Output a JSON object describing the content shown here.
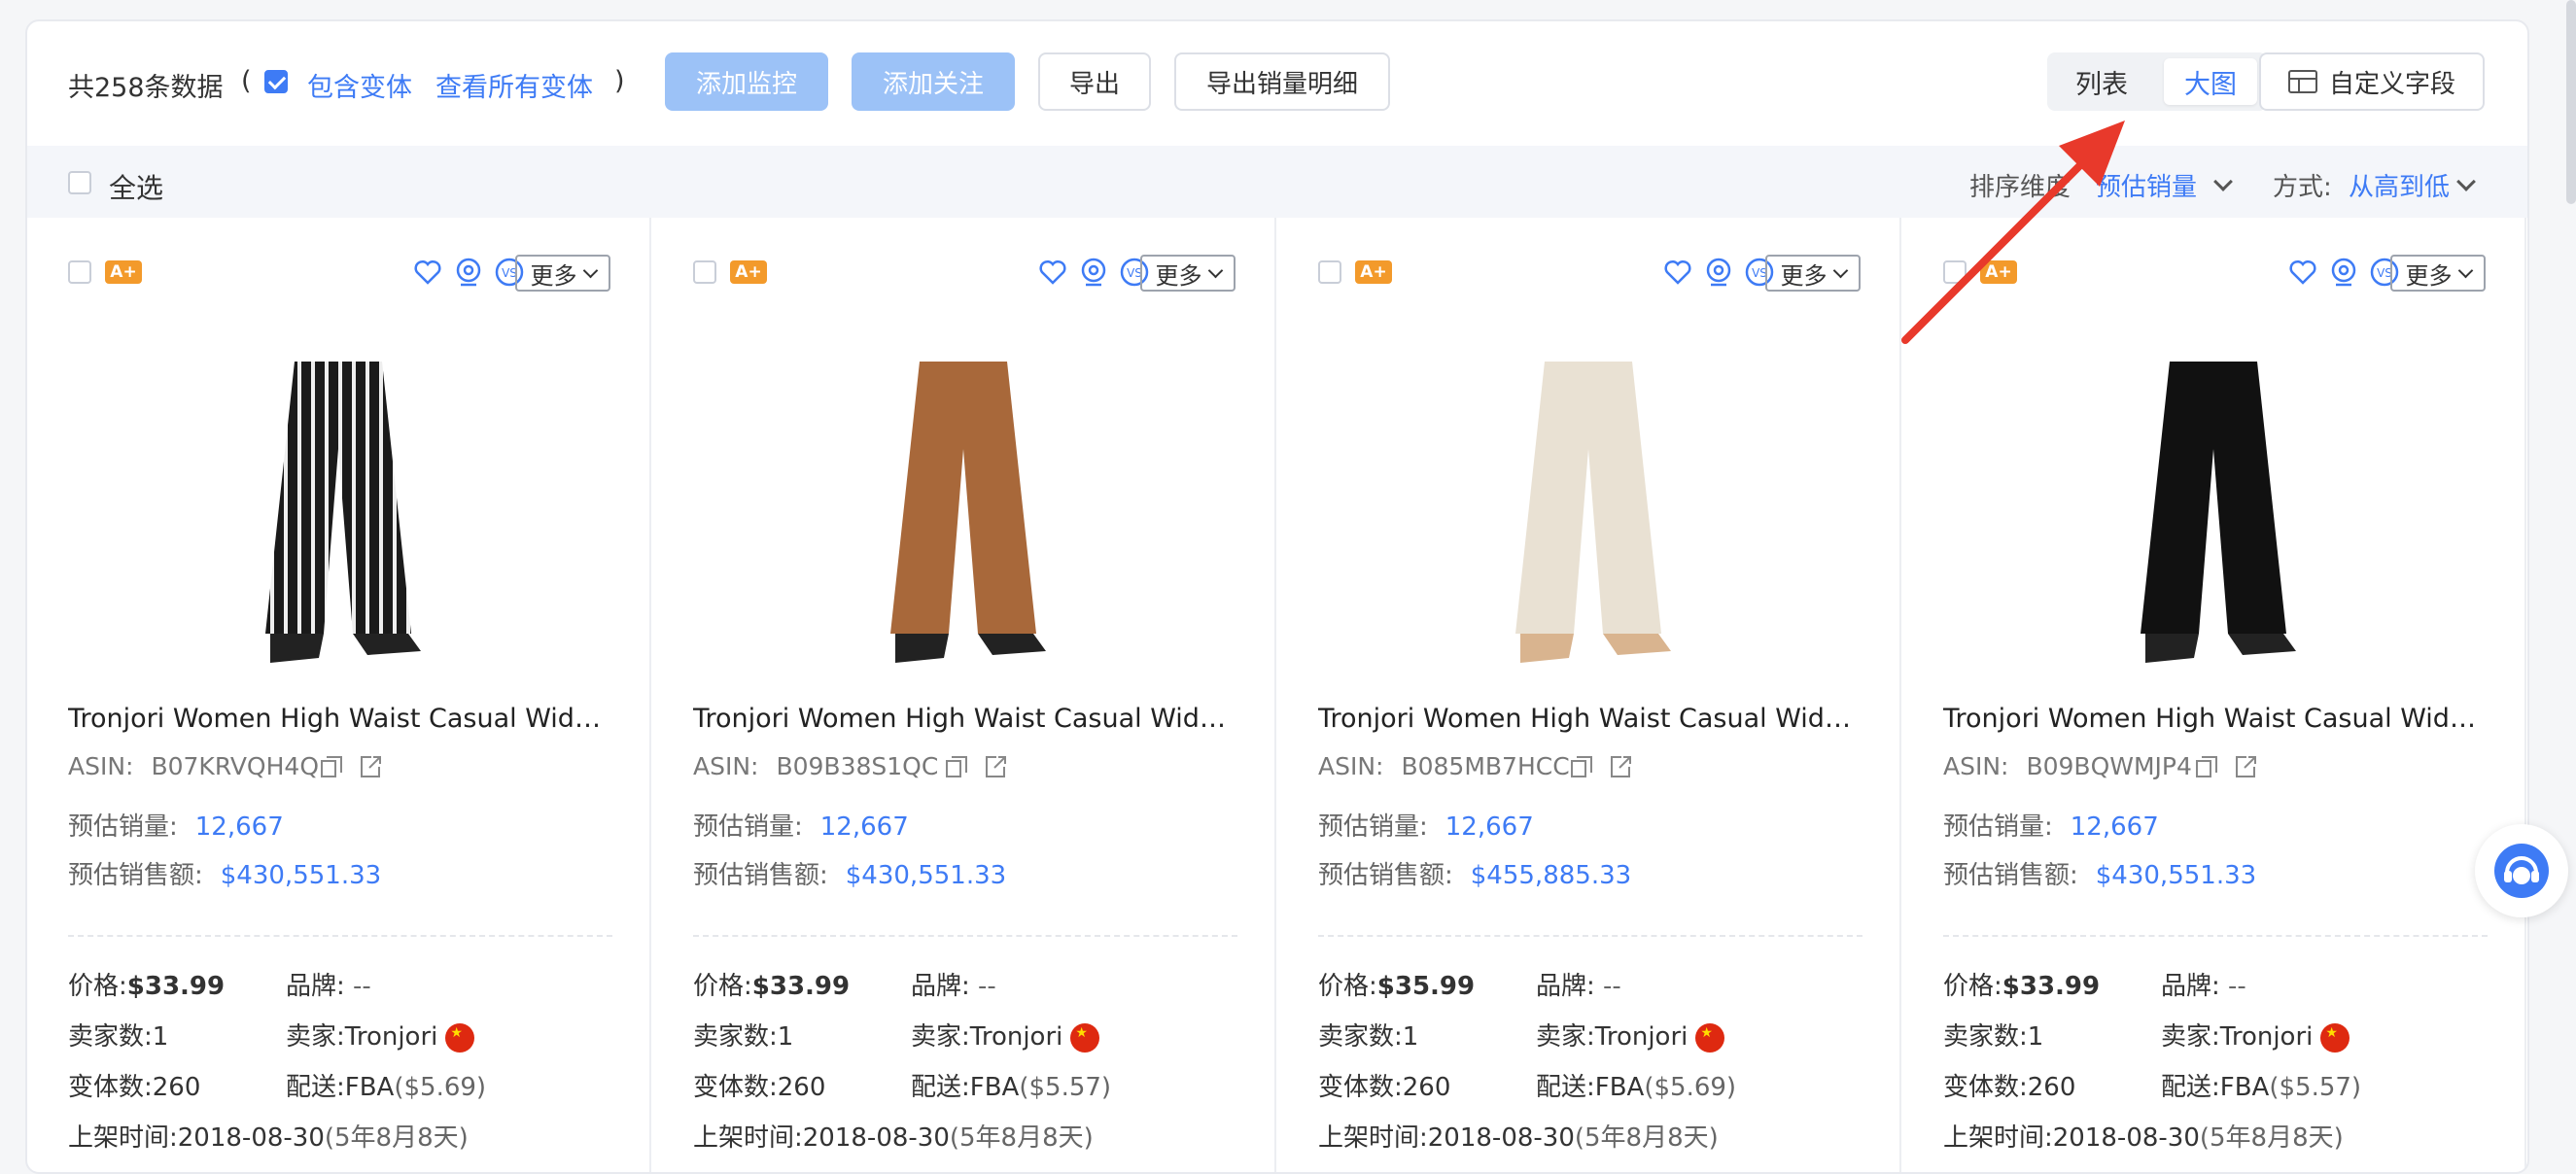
{
  "toolbar": {
    "count_text": "共258条数据",
    "paren_open": "(",
    "paren_close": ")",
    "include_variants": "包含变体",
    "view_all_variants": "查看所有变体",
    "add_monitor": "添加监控",
    "add_follow": "添加关注",
    "export": "导出",
    "export_sales": "导出销量明细",
    "view_list": "列表",
    "view_big": "大图",
    "custom_fields": "自定义字段"
  },
  "selectbar": {
    "select_all": "全选",
    "sort_dim_label": "排序维度",
    "sort_dim_value": "预估销量",
    "order_label": "方式:",
    "order_value": "从高到低"
  },
  "labels": {
    "asin": "ASIN:",
    "est_sales": "预估销量:",
    "est_revenue": "预估销售额:",
    "price": "价格:",
    "brand": "品牌:",
    "seller_count": "卖家数:",
    "seller": "卖家:",
    "variant_count": "变体数:",
    "shipping": "配送:",
    "listed": "上架时间:",
    "more": "更多",
    "badge": "A+"
  },
  "products": [
    {
      "title": "Tronjori Women High Waist Casual Wide Leg Pants",
      "asin": "B07KRVQH4Q",
      "sales": "12,667",
      "revenue": "$430,551.33",
      "price": "$33.99",
      "brand": "--",
      "sellers": "1",
      "seller": "Tronjori",
      "variants": "260",
      "ship": "FBA",
      "ship_fee": "($5.69)",
      "date": "2018-08-30",
      "age": "(5年8月8天)",
      "color": "striped"
    },
    {
      "title": "Tronjori Women High Waist Casual Wide Leg Pants",
      "asin": "B09B38S1QC",
      "sales": "12,667",
      "revenue": "$430,551.33",
      "price": "$33.99",
      "brand": "--",
      "sellers": "1",
      "seller": "Tronjori",
      "variants": "260",
      "ship": "FBA",
      "ship_fee": "($5.57)",
      "date": "2018-08-30",
      "age": "(5年8月8天)",
      "color": "#a8683a"
    },
    {
      "title": "Tronjori Women High Waist Casual Wide Leg Pants",
      "asin": "B085MB7HCC",
      "sales": "12,667",
      "revenue": "$455,885.33",
      "price": "$35.99",
      "brand": "--",
      "sellers": "1",
      "seller": "Tronjori",
      "variants": "260",
      "ship": "FBA",
      "ship_fee": "($5.69)",
      "date": "2018-08-30",
      "age": "(5年8月8天)",
      "color": "#e9e1d3"
    },
    {
      "title": "Tronjori Women High Waist Casual Wide Leg Pants",
      "asin": "B09BQWMJP4",
      "sales": "12,667",
      "revenue": "$430,551.33",
      "price": "$33.99",
      "brand": "--",
      "sellers": "1",
      "seller": "Tronjori",
      "variants": "260",
      "ship": "FBA",
      "ship_fee": "($5.57)",
      "date": "2018-08-30",
      "age": "(5年8月8天)",
      "color": "#111111"
    }
  ]
}
